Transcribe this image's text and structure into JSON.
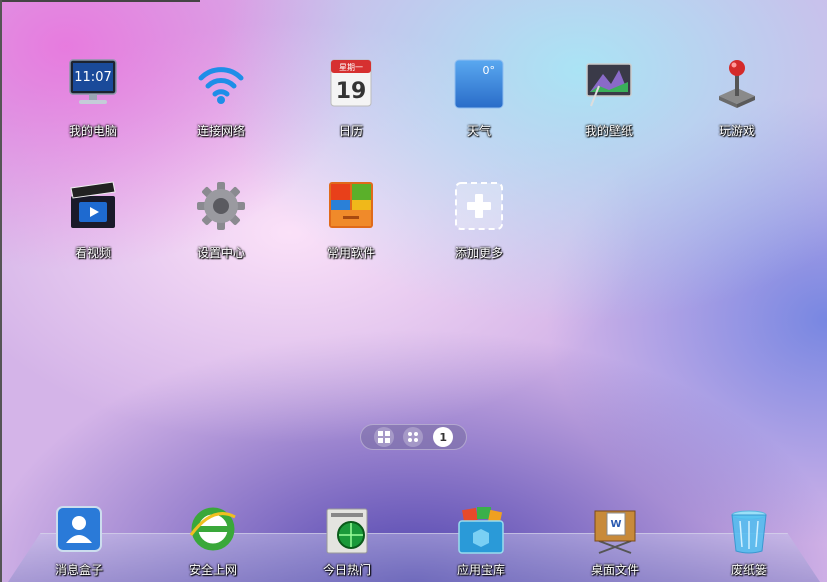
{
  "desktop": {
    "apps": [
      {
        "label": "我的电脑",
        "icon": "monitor-icon",
        "clock": "11:07"
      },
      {
        "label": "连接网络",
        "icon": "wifi-icon"
      },
      {
        "label": "日历",
        "icon": "calendar-icon",
        "weekday": "星期一",
        "day": "19"
      },
      {
        "label": "天气",
        "icon": "weather-icon",
        "temp": "0°"
      },
      {
        "label": "我的壁纸",
        "icon": "wallpaper-icon"
      },
      {
        "label": "玩游戏",
        "icon": "joystick-icon"
      },
      {
        "label": "看视频",
        "icon": "video-icon"
      },
      {
        "label": "设置中心",
        "icon": "gear-icon"
      },
      {
        "label": "常用软件",
        "icon": "software-box-icon"
      },
      {
        "label": "添加更多",
        "icon": "add-more-icon"
      }
    ]
  },
  "page_switcher": {
    "current_page": "1"
  },
  "dock": {
    "items": [
      {
        "label": "消息盒子",
        "icon": "message-box-icon"
      },
      {
        "label": "安全上网",
        "icon": "ie-browser-icon"
      },
      {
        "label": "今日热门",
        "icon": "news-icon"
      },
      {
        "label": "应用宝库",
        "icon": "app-store-icon"
      },
      {
        "label": "桌面文件",
        "icon": "desktop-files-icon"
      },
      {
        "label": "废纸篓",
        "icon": "recycle-bin-icon"
      }
    ]
  },
  "colors": {
    "dock": "#9a9ad0",
    "weather": "#3a80d8",
    "calendar_red": "#d63030"
  }
}
